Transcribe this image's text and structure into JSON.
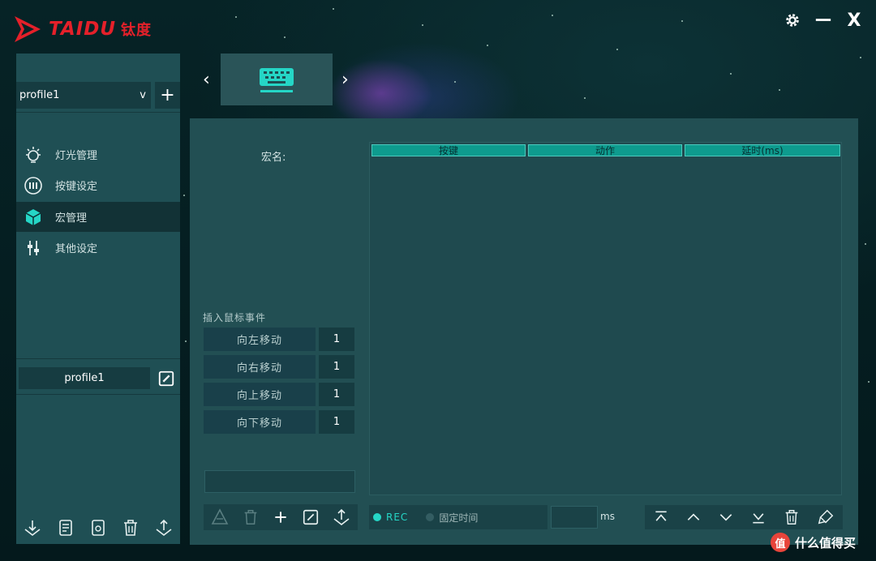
{
  "app": {
    "logo_text": "TAIDU",
    "logo_cn": "钛度"
  },
  "window_controls": {
    "settings": "gear-icon",
    "minimize": "—",
    "close": "X"
  },
  "profile": {
    "selected": "profile1",
    "dropdown_glyph": "v",
    "add_glyph": "+",
    "name": "profile1"
  },
  "nav": [
    {
      "label": "灯光管理",
      "icon": "bulb-icon"
    },
    {
      "label": "按键设定",
      "icon": "keys-icon"
    },
    {
      "label": "宏管理",
      "icon": "cube-icon",
      "active": true
    },
    {
      "label": "其他设定",
      "icon": "sliders-icon"
    }
  ],
  "device": {
    "prev": "‹",
    "next": "›",
    "icon": "keyboard-icon"
  },
  "macro": {
    "name_label": "宏名:",
    "insert_label": "插入鼠标事件",
    "moves": [
      {
        "label": "向左移动",
        "value": "1"
      },
      {
        "label": "向右移动",
        "value": "1"
      },
      {
        "label": "向上移动",
        "value": "1"
      },
      {
        "label": "向下移动",
        "value": "1"
      }
    ]
  },
  "table": {
    "columns": [
      "按键",
      "动作",
      "延时(ms)"
    ]
  },
  "recording": {
    "rec_label": "REC",
    "fixed_time_label": "固定时间",
    "ms_label": "ms"
  },
  "watermark": {
    "logo": "值",
    "text": "什么值得买"
  },
  "colors": {
    "accent": "#25d6c6",
    "logo_red": "#e4202a",
    "panel": "#224f53"
  }
}
